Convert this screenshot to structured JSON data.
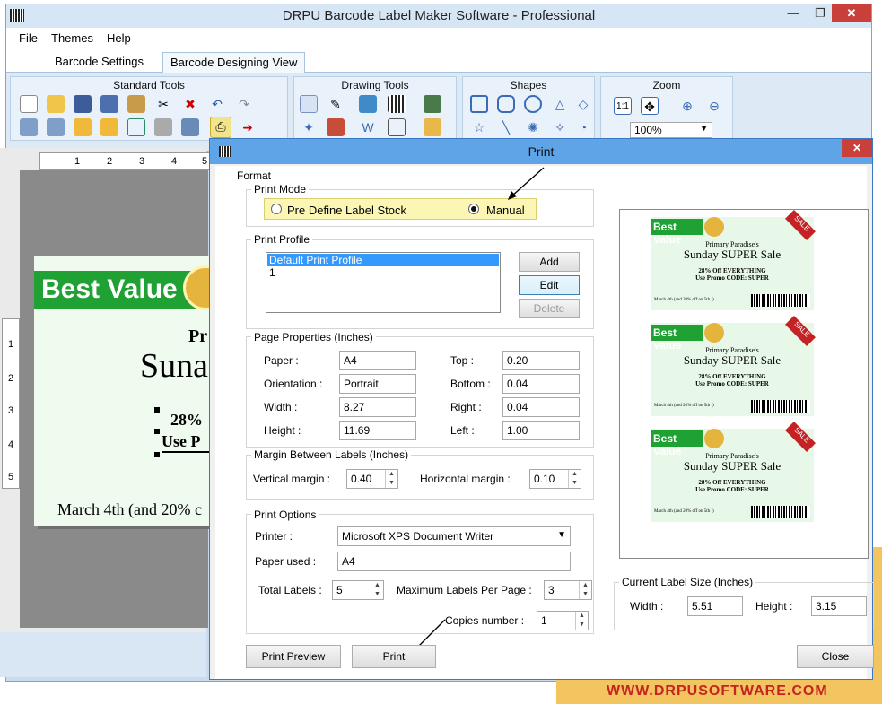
{
  "window": {
    "title": "DRPU Barcode Label Maker Software - Professional"
  },
  "menu": [
    "File",
    "Themes",
    "Help"
  ],
  "tabs": [
    "Barcode Settings",
    "Barcode Designing View"
  ],
  "ribbon": {
    "groups": [
      "Standard Tools",
      "Drawing Tools",
      "Shapes",
      "Zoom"
    ],
    "zoom_value": "100%",
    "zoom_fit_label": "1:1"
  },
  "rulers": {
    "top": [
      "1",
      "2",
      "3",
      "4",
      "5"
    ],
    "left": [
      "1",
      "2",
      "3",
      "4",
      "5"
    ]
  },
  "canvas_label": {
    "best_value": "Best Value",
    "line1": "Pr",
    "line2": "Suna",
    "line3": "28%",
    "line4": "Use P",
    "line5": "March 4th (and 20% c"
  },
  "dialog": {
    "title": "Print",
    "format_label": "Format",
    "print_mode": {
      "title": "Print Mode",
      "option1": "Pre Define Label Stock",
      "option2": "Manual",
      "selected": "Manual"
    },
    "print_profile": {
      "title": "Print Profile",
      "items": [
        "Default Print Profile",
        "1"
      ],
      "add": "Add",
      "edit": "Edit",
      "delete": "Delete"
    },
    "page_properties": {
      "title": "Page Properties (Inches)",
      "paper_label": "Paper :",
      "paper": "A4",
      "orientation_label": "Orientation :",
      "orientation": "Portrait",
      "width_label": "Width :",
      "width": "8.27",
      "height_label": "Height :",
      "height": "11.69",
      "top_label": "Top :",
      "top": "0.20",
      "bottom_label": "Bottom :",
      "bottom": "0.04",
      "right_label": "Right :",
      "right": "0.04",
      "left_label": "Left :",
      "left": "1.00"
    },
    "margin": {
      "title": "Margin Between Labels (Inches)",
      "vertical_label": "Vertical margin :",
      "vertical": "0.40",
      "horizontal_label": "Horizontal margin :",
      "horizontal": "0.10"
    },
    "print_options": {
      "title": "Print Options",
      "printer_label": "Printer :",
      "printer": "Microsoft XPS Document Writer",
      "paper_used_label": "Paper used :",
      "paper_used": "A4",
      "total_labels_label": "Total Labels :",
      "total_labels": "5",
      "max_labels_label": "Maximum Labels Per Page :",
      "max_labels": "3",
      "copies_label": "Copies number :",
      "copies": "1"
    },
    "preview_labels": {
      "best_value": "Best Value",
      "store": "Primary Paradise's",
      "sale": "Sunday SUPER Sale",
      "offer": "28% Off EVERYTHING",
      "promo": "Use Promo CODE: SUPER",
      "date": "March 4th (and 20% off on 5th !)",
      "ribbon": "SALE"
    },
    "current_size": {
      "title": "Current Label Size (Inches)",
      "width_label": "Width :",
      "width": "5.51",
      "height_label": "Height :",
      "height": "3.15"
    },
    "buttons": {
      "preview": "Print Preview",
      "print": "Print",
      "close": "Close"
    }
  },
  "footer": {
    "website": "WWW.DRPUSOFTWARE.COM"
  }
}
